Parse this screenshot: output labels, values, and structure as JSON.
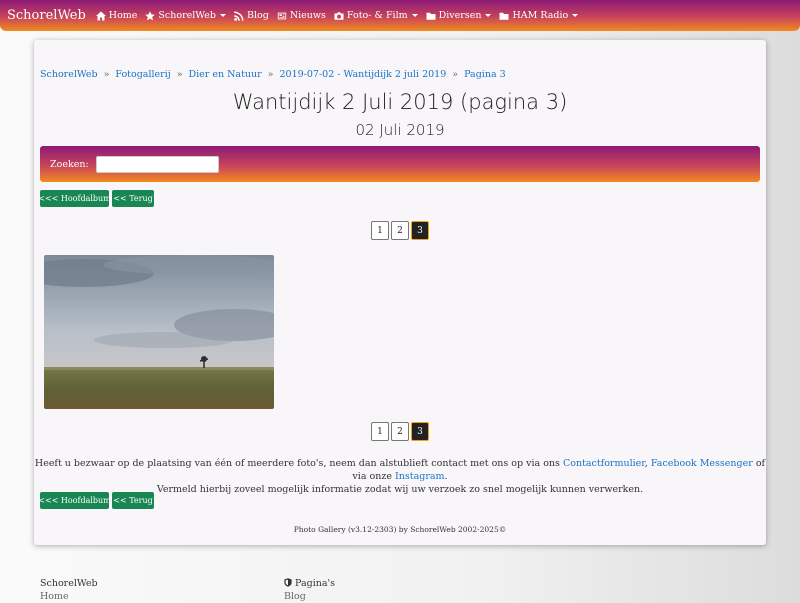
{
  "navbar": {
    "brand": "SchorelWeb",
    "items": [
      {
        "label": "Home",
        "icon": "home-icon",
        "dropdown": false
      },
      {
        "label": "SchorelWeb",
        "icon": "star-icon",
        "dropdown": true
      },
      {
        "label": "Blog",
        "icon": "rss-icon",
        "dropdown": false
      },
      {
        "label": "Nieuws",
        "icon": "newspaper-icon",
        "dropdown": false
      },
      {
        "label": "Foto- & Film",
        "icon": "camera-icon",
        "dropdown": true
      },
      {
        "label": "Diversen",
        "icon": "folder-icon",
        "dropdown": true
      },
      {
        "label": "HAM Radio",
        "icon": "folder-icon",
        "dropdown": true
      }
    ]
  },
  "breadcrumb": [
    "SchorelWeb",
    "Fotogallerij",
    "Dier en Natuur",
    "2019-07-02 - Wantijdijk 2 juli 2019",
    "Pagina 3"
  ],
  "breadcrumb_sep": "»",
  "title": "Wantijdijk 2 Juli 2019 (pagina 3)",
  "subtitle": "02 Juli 2019",
  "search": {
    "label": "Zoeken:",
    "value": ""
  },
  "buttons": {
    "main_album": "<<< Hoofdalbum",
    "back": "<< Terug"
  },
  "pagination": {
    "pages": [
      "1",
      "2",
      "3"
    ],
    "current": "3"
  },
  "notice": {
    "line1_prefix": "Heeft u bezwaar op de plaatsing van één of meerdere foto's, neem dan alstublieft contact met ons op via ons",
    "link_contact": "Contactformulier",
    "comma": ",",
    "link_messenger": "Facebook Messenger",
    "or_via": "of via onze",
    "link_instagram": "Instagram",
    "period": ".",
    "line2": "Vermeld hierbij zoveel mogelijk informatie zodat wij uw verzoek zo snel mogelijk kunnen verwerken."
  },
  "credits": "Photo Gallery (v3.12-2303) by SchorelWeb 2002-2025©",
  "footer": {
    "col1": {
      "heading": "SchorelWeb",
      "link": "Home"
    },
    "col2": {
      "heading": "Pagina's",
      "icon": "shield-icon",
      "link": "Blog"
    }
  },
  "colors": {
    "accent_start": "#8c1a78",
    "accent_end": "#f28a1f",
    "button_green": "#198754",
    "link_blue": "#1a73c9"
  }
}
